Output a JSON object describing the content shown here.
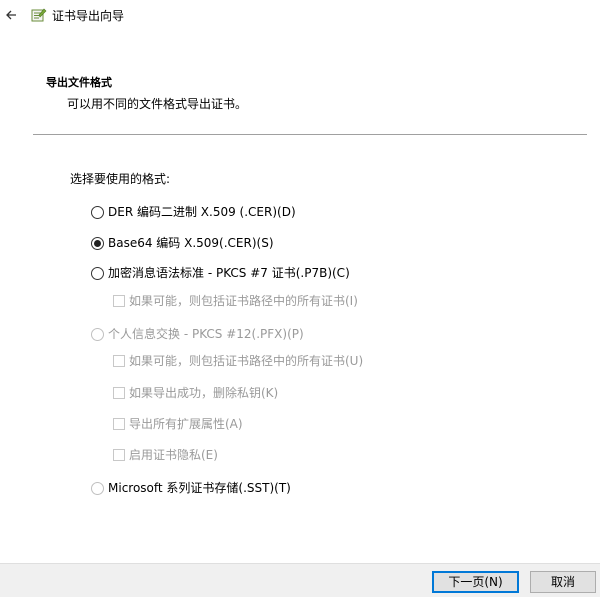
{
  "window": {
    "title": "证书导出向导",
    "back_icon": "back-arrow-icon",
    "app_icon": "certificate-wizard-icon"
  },
  "header": {
    "title": "导出文件格式",
    "subtitle": "可以用不同的文件格式导出证书。"
  },
  "form": {
    "prompt": "选择要使用的格式:",
    "options": {
      "der": {
        "label": "DER 编码二进制 X.509 (.CER)(D)",
        "selected": false,
        "enabled": true
      },
      "base64": {
        "label": "Base64 编码 X.509(.CER)(S)",
        "selected": true,
        "enabled": true
      },
      "pkcs7": {
        "label": "加密消息语法标准 - PKCS #7 证书(.P7B)(C)",
        "selected": false,
        "enabled": true
      },
      "pkcs7_include_all": {
        "label": "如果可能，则包括证书路径中的所有证书(I)",
        "checked": false,
        "enabled": false
      },
      "pfx": {
        "label": "个人信息交换 - PKCS #12(.PFX)(P)",
        "selected": false,
        "enabled": false
      },
      "pfx_include_all": {
        "label": "如果可能，则包括证书路径中的所有证书(U)",
        "checked": false,
        "enabled": false
      },
      "pfx_delete_key": {
        "label": "如果导出成功，删除私钥(K)",
        "checked": false,
        "enabled": false
      },
      "pfx_export_props": {
        "label": "导出所有扩展属性(A)",
        "checked": false,
        "enabled": false
      },
      "pfx_privacy": {
        "label": "启用证书隐私(E)",
        "checked": false,
        "enabled": false
      },
      "sst": {
        "label": "Microsoft 系列证书存储(.SST)(T)",
        "selected": false,
        "enabled": false
      }
    }
  },
  "footer": {
    "next_label": "下一页(N)",
    "cancel_label": "取消"
  }
}
